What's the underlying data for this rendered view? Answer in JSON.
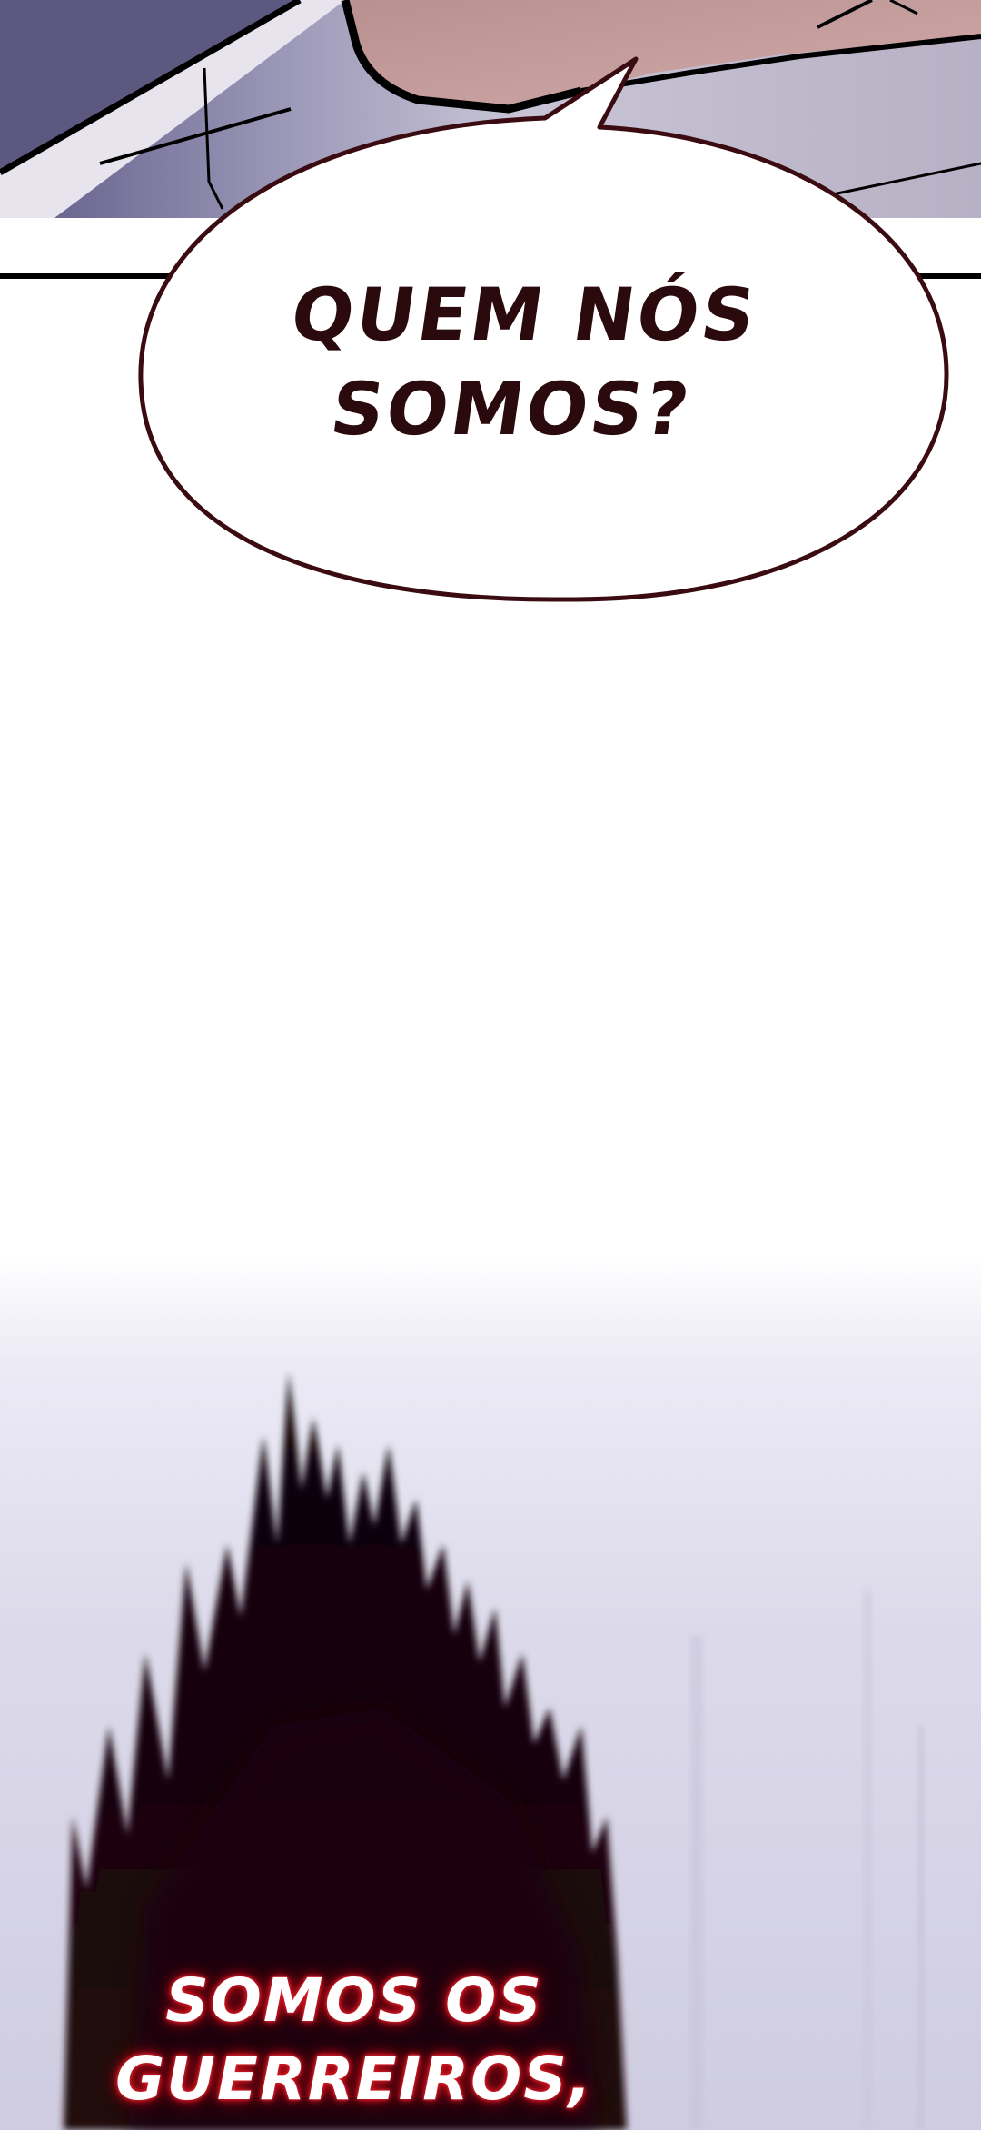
{
  "panel_top": {
    "speech_bubble": {
      "lines": [
        "QUEM NÓS",
        "SOMOS?"
      ]
    }
  },
  "panel_bottom": {
    "narration": {
      "lines": [
        "SOMOS OS",
        "GUERREIROS,"
      ]
    }
  },
  "colors": {
    "bubble_text": "#2a0a0c",
    "bubble_outline": "#3a0b10",
    "narration_glow": "#d0101c",
    "silhouette": "#1a060a"
  }
}
